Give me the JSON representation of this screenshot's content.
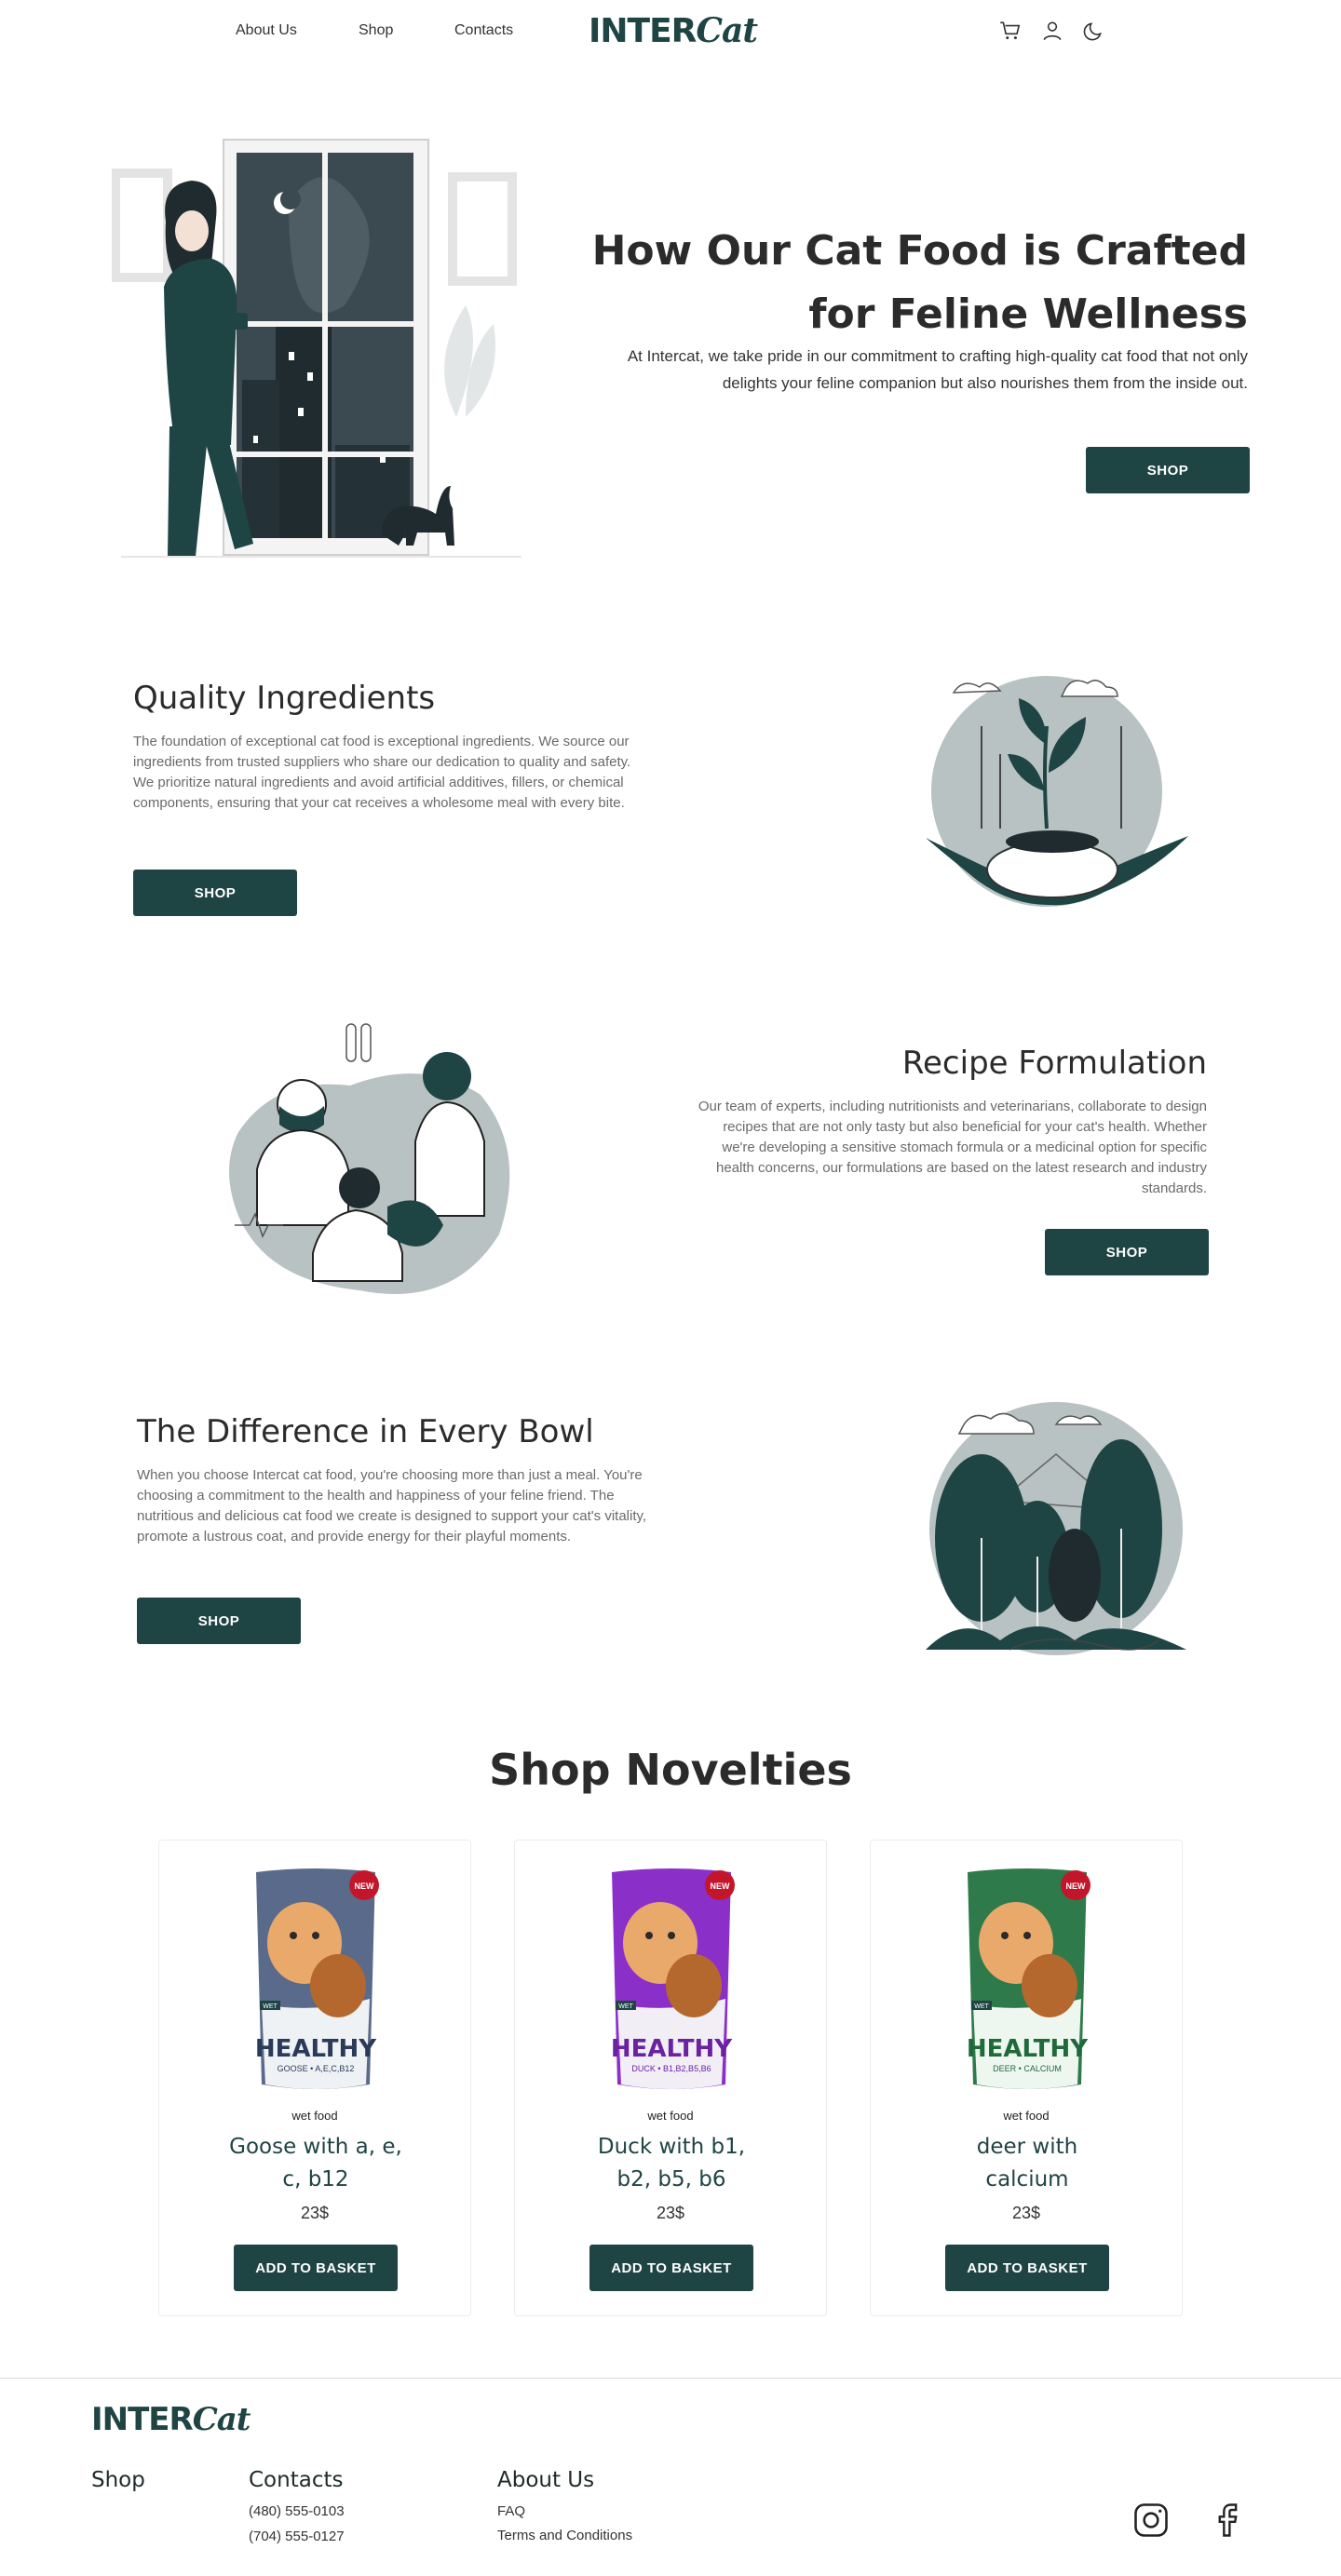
{
  "nav": {
    "links": [
      "About Us",
      "Shop",
      "Contacts"
    ],
    "logo": {
      "part1": "INTER",
      "part2": "Cat"
    },
    "icons": [
      "cart-icon",
      "user-icon",
      "moon-icon"
    ]
  },
  "hero": {
    "title_line1": "How Our Cat Food is Crafted",
    "title_line2": "for Feline Wellness",
    "text": "At Intercat, we take pride in our commitment to crafting high-quality cat food that not only delights your feline companion but also nourishes them from the inside out.",
    "button": "SHOP"
  },
  "sections": [
    {
      "title": "Quality Ingredients",
      "text": "The foundation of exceptional cat food is exceptional ingredients. We source our ingredients from trusted suppliers who share our dedication to quality and safety. We prioritize natural ingredients and avoid artificial additives, fillers, or chemical components, ensuring that your cat receives a wholesome meal with every bite.",
      "button": "SHOP"
    },
    {
      "title": "Recipe Formulation",
      "text": "Our team of experts, including nutritionists and veterinarians, collaborate to design recipes that are not only tasty but also beneficial for your cat's health. Whether we're developing a sensitive stomach formula or a medicinal option for specific health concerns, our formulations are based on the latest research and industry standards.",
      "button": "SHOP"
    },
    {
      "title": "The Difference in Every Bowl",
      "text": "When you choose Intercat cat food, you're choosing more than just a meal. You're choosing a commitment to the health and happiness of your feline friend. The nutritious and delicious cat food we create is designed to support your cat's vitality, promote a lustrous coat, and provide energy for their playful moments.",
      "button": "SHOP"
    }
  ],
  "novelties": {
    "title": "Shop Novelties",
    "products": [
      {
        "kind": "wet food",
        "name": "Goose with a, e, c, b12",
        "price": "23$",
        "button": "ADD TO BASKET",
        "pack_brand": "HEALTHY",
        "pack_sub": "GOOSE • A,E,C,B12",
        "badge": "NEW",
        "tag": "WET",
        "color": "#5a6a8a"
      },
      {
        "kind": "wet food",
        "name": "Duck with b1, b2, b5, b6",
        "price": "23$",
        "button": "ADD TO BASKET",
        "pack_brand": "HEALTHY",
        "pack_sub": "DUCK • B1,B2,B5,B6",
        "badge": "NEW",
        "tag": "WET",
        "color": "#8b2fc9"
      },
      {
        "kind": "wet food",
        "name": "deer with calcium",
        "price": "23$",
        "button": "ADD TO BASKET",
        "pack_brand": "HEALTHY",
        "pack_sub": "DEER • CALCIUM",
        "badge": "NEW",
        "tag": "WET",
        "color": "#2f7a4a"
      }
    ]
  },
  "footer": {
    "logo": {
      "part1": "INTER",
      "part2": "Cat"
    },
    "shop": "Shop",
    "contacts": {
      "title": "Contacts",
      "phones": [
        "(480) 555-0103",
        "(704) 555-0127"
      ]
    },
    "about": {
      "title": "About Us",
      "links": [
        "FAQ",
        "Terms and Conditions"
      ]
    },
    "social": [
      "instagram-icon",
      "facebook-icon"
    ]
  },
  "colors": {
    "accent": "#1f4444",
    "illustration_gray": "#b8c2c2"
  }
}
